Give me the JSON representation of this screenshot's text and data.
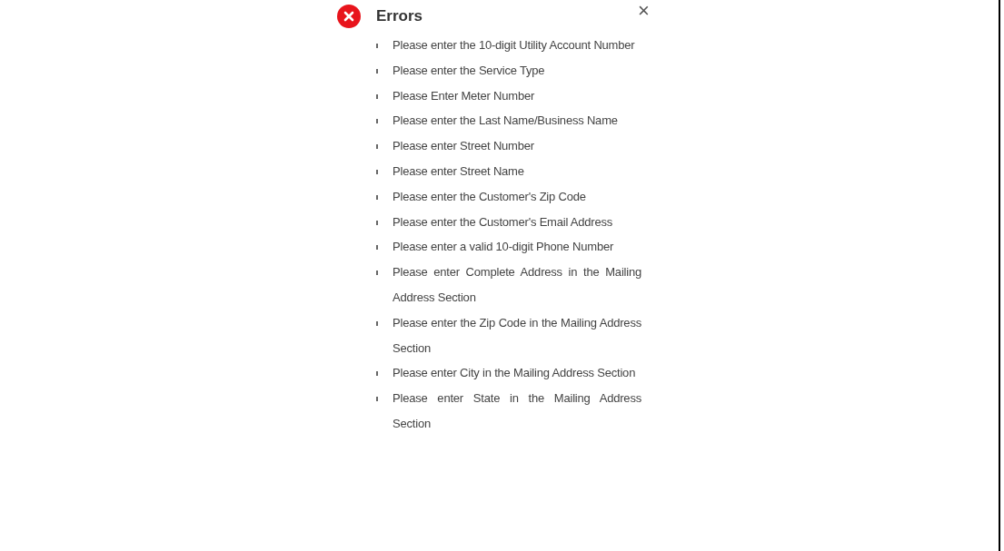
{
  "alert": {
    "title": "Errors",
    "close_label": "×",
    "messages": [
      "Please enter the 10-digit Utility Account Number",
      "Please enter the Service Type",
      "Please Enter Meter Number",
      "Please enter the Last Name/Business Name",
      "Please enter Street Number",
      "Please enter Street Name",
      "Please enter the Customer's Zip Code",
      "Please enter the Customer's Email Address",
      "Please enter a valid 10-digit Phone Number",
      "Please enter Complete Address in the Mailing Address Section",
      "Please enter the Zip Code in the Mailing Address Section",
      "Please enter City in the Mailing Address Section",
      "Please enter State in the Mailing Address Section"
    ]
  }
}
